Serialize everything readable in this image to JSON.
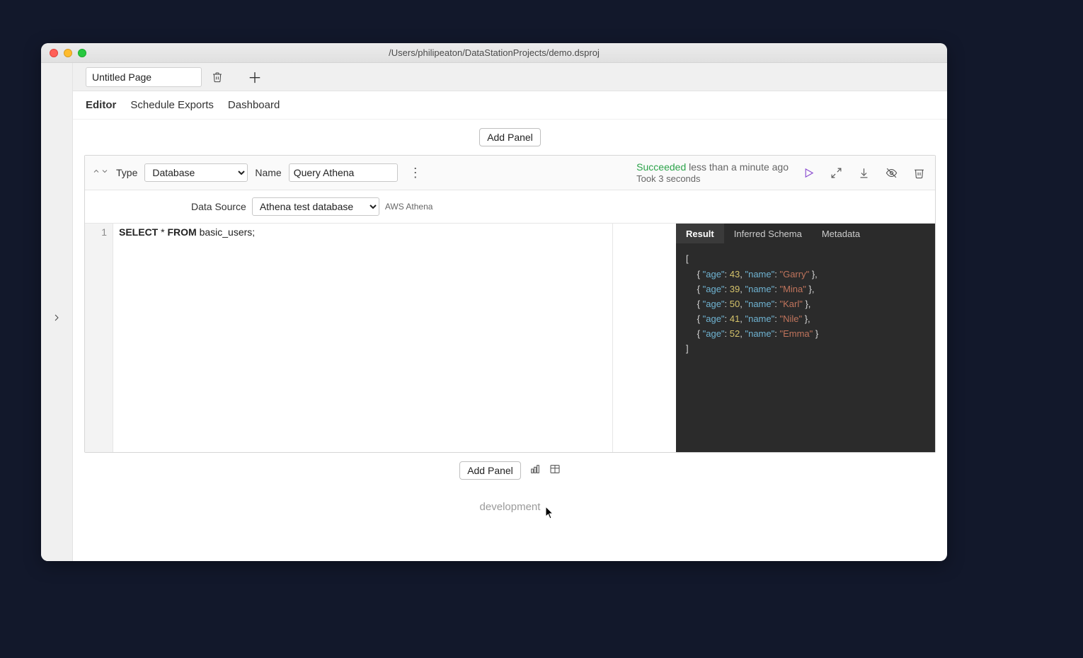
{
  "window": {
    "title": "/Users/philipeaton/DataStationProjects/demo.dsproj"
  },
  "page": {
    "name": "Untitled Page"
  },
  "nav": {
    "editor": "Editor",
    "schedule": "Schedule Exports",
    "dashboard": "Dashboard"
  },
  "buttons": {
    "add_panel": "Add Panel"
  },
  "panel": {
    "type_label": "Type",
    "type_value": "Database",
    "name_label": "Name",
    "name_value": "Query Athena",
    "status_succeeded": "Succeeded",
    "status_when": "less than a minute ago",
    "status_took": "Took 3 seconds",
    "ds_label": "Data Source",
    "ds_value": "Athena test database",
    "ds_type": "AWS Athena",
    "code_line_no": "1",
    "code_kw1": "SELECT",
    "code_star": " * ",
    "code_kw2": "FROM",
    "code_rest": " basic_users;"
  },
  "result_tabs": {
    "result": "Result",
    "schema": "Inferred Schema",
    "meta": "Metadata"
  },
  "result_rows": [
    {
      "age": 43,
      "name": "Garry"
    },
    {
      "age": 39,
      "name": "Mina"
    },
    {
      "age": 50,
      "name": "Karl"
    },
    {
      "age": 41,
      "name": "Nile"
    },
    {
      "age": 52,
      "name": "Emma"
    }
  ],
  "footer": {
    "env": "development"
  }
}
